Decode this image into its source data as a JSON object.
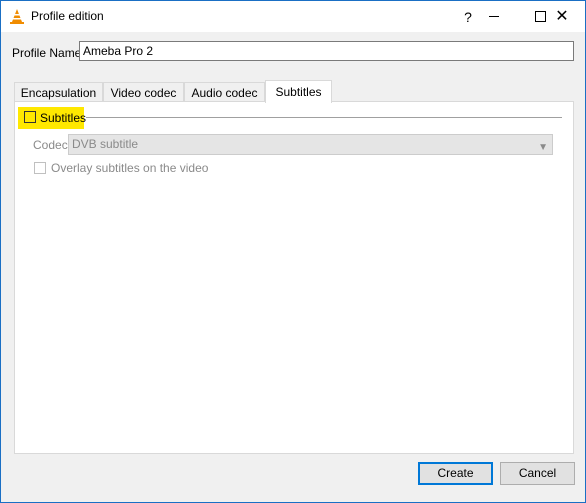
{
  "window": {
    "title": "Profile edition",
    "help_label": "?",
    "close_label": "✕"
  },
  "profile": {
    "label": "Profile Name",
    "value": "Ameba Pro 2"
  },
  "tabs": [
    {
      "label": "Encapsulation",
      "selected": false
    },
    {
      "label": "Video codec",
      "selected": false
    },
    {
      "label": "Audio codec",
      "selected": false
    },
    {
      "label": "Subtitles",
      "selected": true
    }
  ],
  "subtitles": {
    "group_label": "Subtitles",
    "checked": false,
    "codec_label": "Codec",
    "codec_value": "DVB subtitle",
    "overlay_label": "Overlay subtitles on the video",
    "overlay_checked": false
  },
  "buttons": {
    "create": "Create",
    "cancel": "Cancel"
  },
  "colors": {
    "highlight": "#ffe800",
    "window_border": "#1a6fc4",
    "default_button_border": "#0078d7"
  }
}
